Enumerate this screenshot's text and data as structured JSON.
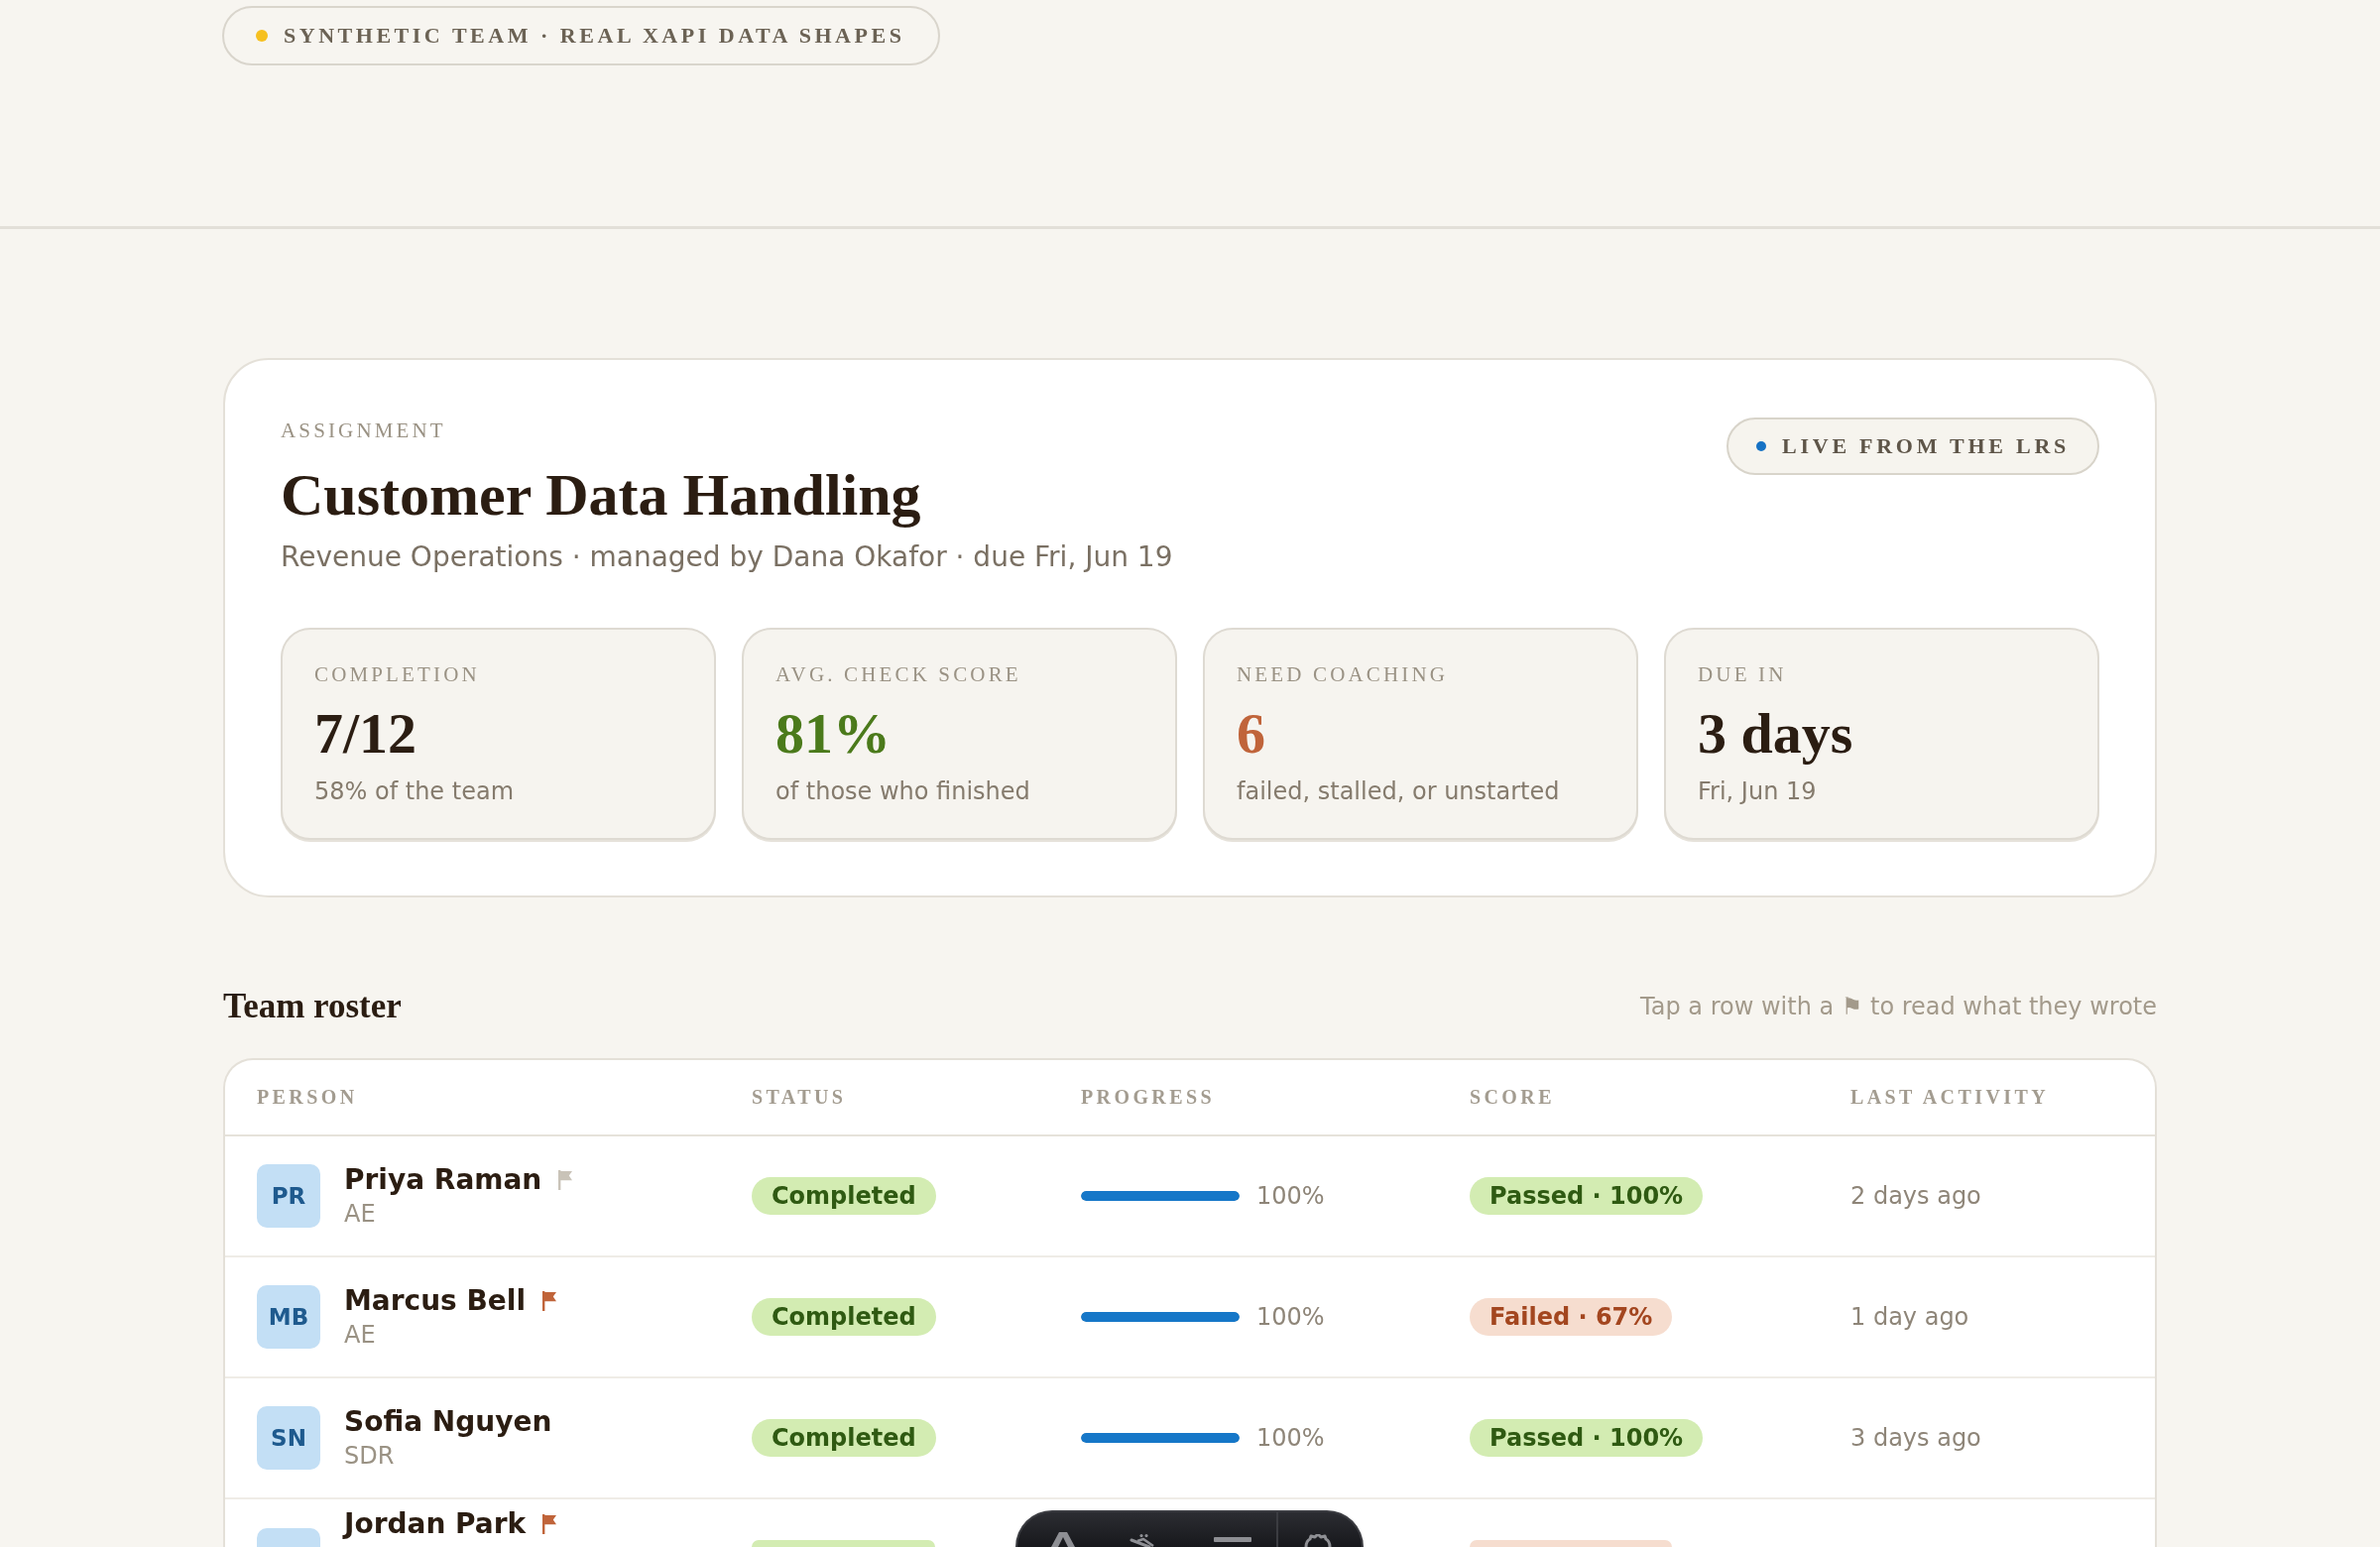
{
  "banner": "SYNTHETIC TEAM · REAL XAPI DATA SHAPES",
  "assignment": {
    "eyebrow": "ASSIGNMENT",
    "title": "Customer Data Handling",
    "subtitle": "Revenue Operations · managed by Dana Okafor · due Fri, Jun 19",
    "live_badge": "LIVE FROM THE LRS",
    "stats": [
      {
        "label": "COMPLETION",
        "value": "7/12",
        "note": "58% of the team",
        "color": "#2b1d12"
      },
      {
        "label": "AVG. CHECK SCORE",
        "value": "81%",
        "note": "of those who finished",
        "color": "#4b7a1b"
      },
      {
        "label": "NEED COACHING",
        "value": "6",
        "note": "failed, stalled, or unstarted",
        "color": "#c0643a"
      },
      {
        "label": "DUE IN",
        "value": "3 days",
        "note": "Fri, Jun 19",
        "color": "#2b1d12"
      }
    ]
  },
  "roster": {
    "title": "Team roster",
    "hint": "Tap a row with a ⚑ to read what they wrote",
    "columns": [
      "PERSON",
      "STATUS",
      "PROGRESS",
      "SCORE",
      "LAST ACTIVITY"
    ],
    "rows": [
      {
        "kind": "full",
        "initials": "PR",
        "name": "Priya Raman",
        "role": "AE",
        "flag": {
          "color": "#c9c3b8"
        },
        "status": {
          "kind": "done",
          "text": "Completed"
        },
        "progress": {
          "level": 1,
          "text": "100%"
        },
        "score": {
          "kind": "pass",
          "text": "Passed · 100%"
        },
        "activity": "2 days ago"
      },
      {
        "kind": "full",
        "initials": "MB",
        "name": "Marcus Bell",
        "role": "AE",
        "flag": {
          "color": "#c0643a"
        },
        "status": {
          "kind": "done",
          "text": "Completed"
        },
        "progress": {
          "level": 1,
          "text": "100%"
        },
        "score": {
          "kind": "fail",
          "text": "Failed · 67%"
        },
        "activity": "1 day ago"
      },
      {
        "kind": "full",
        "initials": "SN",
        "name": "Sofia Nguyen",
        "role": "SDR",
        "status": {
          "kind": "done",
          "text": "Completed"
        },
        "progress": {
          "level": 1,
          "text": "100%"
        },
        "score": {
          "kind": "pass",
          "text": "Passed · 100%"
        },
        "activity": "3 days ago"
      },
      {
        "kind": "cut",
        "name": "Jordan Park",
        "flag": {
          "color": "#c0643a"
        },
        "status": {
          "kind": "done"
        },
        "score": {
          "kind": "fail"
        }
      }
    ]
  }
}
